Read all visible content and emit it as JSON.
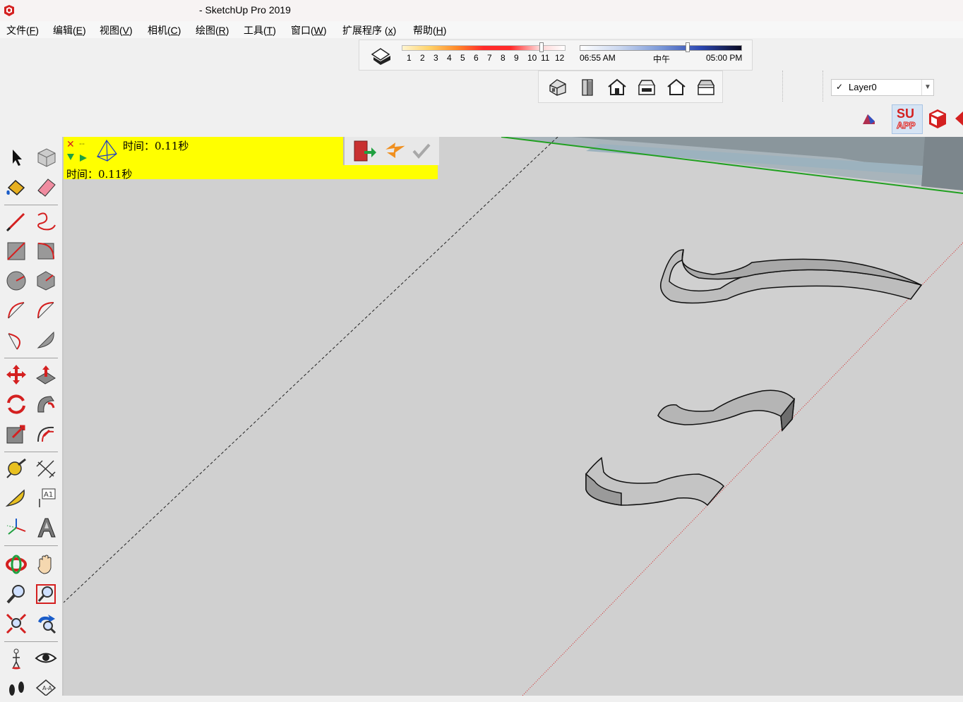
{
  "window": {
    "title": "- SketchUp Pro 2019"
  },
  "menu": [
    {
      "label": "文件(",
      "key": "F",
      "end": ")"
    },
    {
      "label": "编辑(",
      "key": "E",
      "end": ")"
    },
    {
      "label": "视图(",
      "key": "V",
      "end": ")"
    },
    {
      "label": "相机(",
      "key": "C",
      "end": ")"
    },
    {
      "label": "绘图(",
      "key": "R",
      "end": ")"
    },
    {
      "label": "工具(",
      "key": "T",
      "end": ")"
    },
    {
      "label": "窗口(",
      "key": "W",
      "end": ")"
    },
    {
      "label": "扩展程序 (",
      "key": "x",
      "end": ")"
    },
    {
      "label": "帮助(",
      "key": "H",
      "end": ")"
    }
  ],
  "shadows": {
    "months": [
      "1",
      "2",
      "3",
      "4",
      "5",
      "6",
      "7",
      "8",
      "9",
      "10",
      "11",
      "12"
    ],
    "time_start": "06:55 AM",
    "time_noon": "中午",
    "time_end": "05:00 PM"
  },
  "layers": {
    "current": "Layer0",
    "check": "✓"
  },
  "extensions": {
    "su_app_top": "SU",
    "su_app_bottom": "APP"
  },
  "status": {
    "line1": "时间：0.11秒",
    "line2": "时间：0.11秒",
    "close_glyph": "✕",
    "dash_glyph": "--"
  },
  "tools": [
    "select-tool-icon",
    "make-component-icon",
    "paint-bucket-icon",
    "eraser-icon",
    "line-tool-icon",
    "freehand-icon",
    "rectangle-icon",
    "rotated-rectangle-icon",
    "circle-icon",
    "polygon-icon",
    "arc-icon",
    "two-point-arc-icon",
    "three-point-arc-icon",
    "pie-icon",
    "move-icon",
    "push-pull-icon",
    "rotate-icon",
    "follow-me-icon",
    "scale-icon",
    "offset-icon",
    "tape-measure-icon",
    "dimension-icon",
    "protractor-icon",
    "text-icon",
    "axes-icon",
    "3d-text-icon",
    "orbit-icon",
    "pan-icon",
    "zoom-icon",
    "zoom-window-icon",
    "zoom-extents-icon",
    "previous-view-icon",
    "position-camera-icon",
    "look-around-icon",
    "walk-icon",
    "section-plane-icon"
  ],
  "colors": {
    "status_bg": "#ffff00",
    "viewport_bg": "#d0d0d0",
    "accent_red": "#d42020"
  }
}
